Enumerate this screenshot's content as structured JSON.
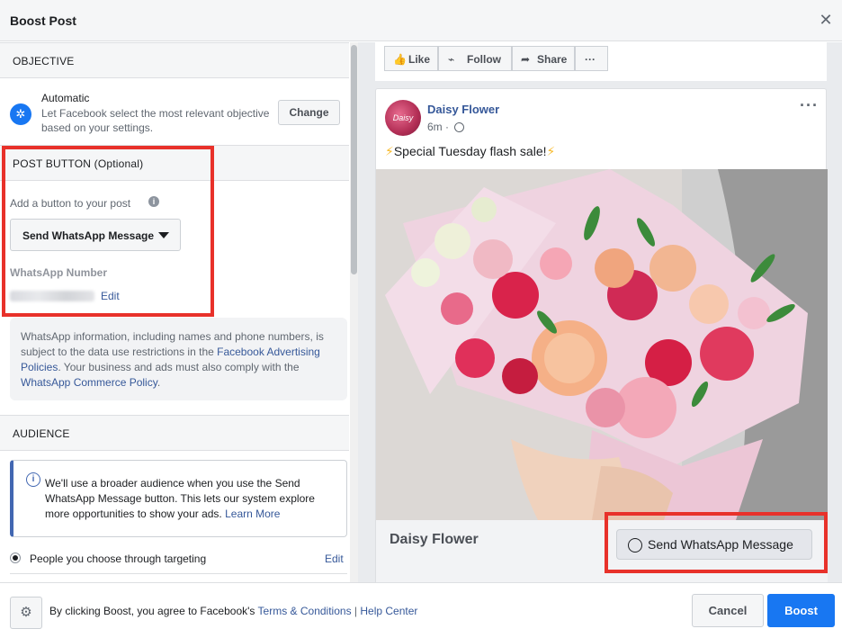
{
  "dialog": {
    "title": "Boost Post",
    "close_icon": "close-icon"
  },
  "objective": {
    "heading": "OBJECTIVE",
    "title": "Automatic",
    "description": "Let Facebook select the most relevant objective based on your settings.",
    "change_label": "Change"
  },
  "post_button": {
    "heading": "POST BUTTON (Optional)",
    "add_label": "Add a button to your post",
    "selected": "Send WhatsApp Message",
    "number_label": "WhatsApp Number",
    "edit_label": "Edit"
  },
  "notice": {
    "text_before": "WhatsApp information, including names and phone numbers, is subject to the data use restrictions in the ",
    "link1": "Facebook Advertising Policies",
    "text_middle": ". Your business and ads must also comply with the ",
    "link2": "WhatsApp Commerce Policy",
    "text_after": "."
  },
  "audience": {
    "heading": "AUDIENCE",
    "info_text": "We'll use a broader audience when you use the Send WhatsApp Message button. This lets our system explore more opportunities to show your ads. ",
    "learn_more": "Learn More",
    "option_label": "People you choose through targeting",
    "edit_label": "Edit"
  },
  "preview_actions": {
    "like": "Like",
    "follow": "Follow",
    "share": "Share",
    "more": "···"
  },
  "post": {
    "page_name": "Daisy Flower",
    "avatar_text": "Daisy",
    "time": "6m ·",
    "text": "Special Tuesday flash sale!",
    "more": "···",
    "cta_title": "Daisy Flower",
    "cta_button": "Send WhatsApp Message"
  },
  "footer": {
    "text_before": "By clicking Boost, you agree to Facebook's ",
    "terms_link": "Terms & Conditions",
    "separator": " | ",
    "help_link": "Help Center",
    "cancel_label": "Cancel",
    "boost_label": "Boost"
  },
  "colors": {
    "accent": "#1877f2",
    "link": "#365899",
    "highlight_box": "#e8312a"
  }
}
